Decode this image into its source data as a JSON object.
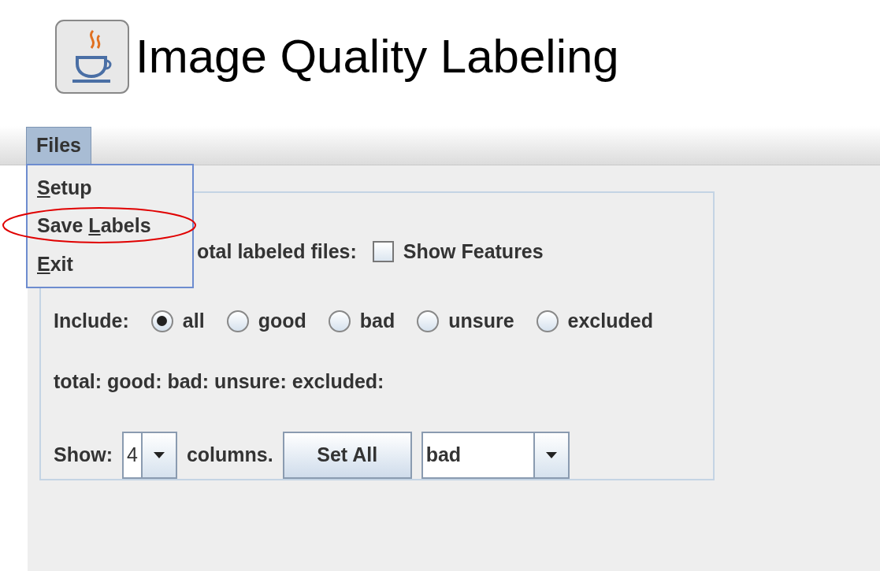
{
  "window": {
    "title": "Image Quality Labeling"
  },
  "menu_bar": [
    {
      "label": "Files",
      "selected": true
    }
  ],
  "menu": {
    "items": [
      {
        "mnemonic": "S",
        "label_rest": "etup",
        "circled": false
      },
      {
        "label_start": "Save ",
        "mnemonic": "L",
        "label_rest": "abels",
        "circled": true
      },
      {
        "mnemonic": "E",
        "label_rest": "xit",
        "circled": false
      }
    ]
  },
  "panel": {
    "labeled_text": "otal labeled files:",
    "show_features": {
      "label": "Show Features",
      "checked": false
    },
    "include_label": "Include:",
    "include_options": [
      {
        "label": "all",
        "selected": true
      },
      {
        "label": "good",
        "selected": false
      },
      {
        "label": "bad",
        "selected": false
      },
      {
        "label": "unsure",
        "selected": false
      },
      {
        "label": "excluded",
        "selected": false
      }
    ],
    "totals": "total: good: bad: unsure: excluded:",
    "show_label": "Show:",
    "columns_value": "4",
    "columns_label": "columns.",
    "set_all_button": "Set All",
    "label_value": "bad"
  }
}
